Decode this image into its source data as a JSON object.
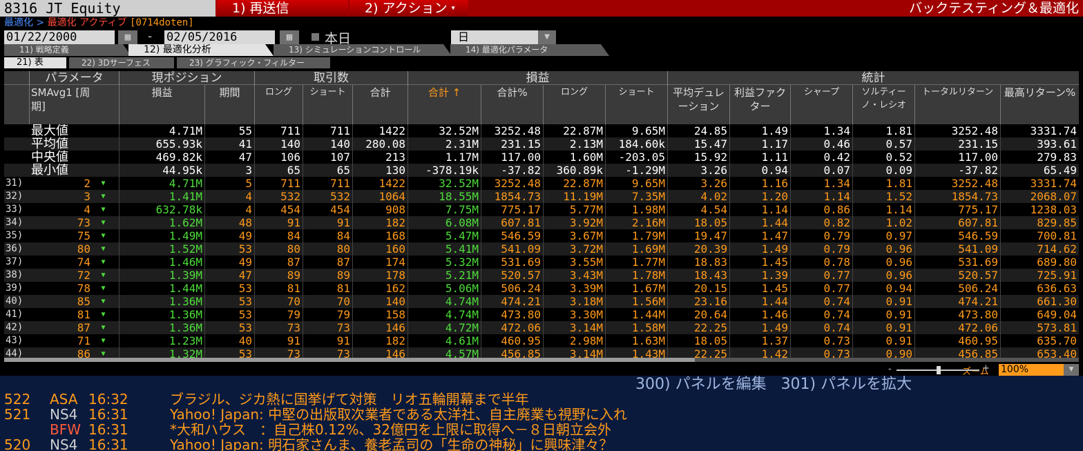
{
  "header": {
    "ticker": "8316 JT Equity",
    "btn_resend": "1) 再送信",
    "btn_action": "2) アクション",
    "title": "バックテスティング＆最適化"
  },
  "breadcrumb": {
    "level1": "最適化",
    "separator": ">",
    "level2": "最適化 アクティブ",
    "code": "[0714doten]"
  },
  "dates": {
    "start": "01/22/2000",
    "dash": "-",
    "end": "02/05/2016",
    "today_label": "本日",
    "interval": "日"
  },
  "tabs": [
    {
      "label": "11) 戦略定義"
    },
    {
      "label": "12) 最適化分析"
    },
    {
      "label": "13) シミュレーションコントロール"
    },
    {
      "label": "14) 最適化パラメータ"
    }
  ],
  "subtabs": [
    {
      "label": "21) 表"
    },
    {
      "label": "22) 3Dサーフェス"
    },
    {
      "label": "23) グラフィック・フィルター"
    }
  ],
  "group_headers": [
    "パラメータ",
    "現ポジション",
    "取引数",
    "損益",
    "統計"
  ],
  "columns": [
    "SMAvg1 [周期]",
    "損益",
    "期間",
    "ロング",
    "ショート",
    "合計",
    "合計 ↑",
    "合計%",
    "ロング",
    "ショート",
    "平均デュレーション",
    "利益ファクター",
    "シャープ",
    "ソルティーノ・レシオ",
    "トータルリターン",
    "最高リターン%"
  ],
  "summary_rows": [
    {
      "label": "最大値",
      "pnl": "4.71M",
      "period": "55",
      "long": "711",
      "short": "711",
      "total": "1422",
      "pl_total": "32.52M",
      "pl_pct": "3252.48",
      "pl_long": "22.87M",
      "pl_short": "9.65M",
      "avg_dur": "24.85",
      "pf": "1.49",
      "sharpe": "1.34",
      "sortino": "1.81",
      "tr": "3252.48",
      "max_ret": "3331.74"
    },
    {
      "label": "平均値",
      "pnl": "655.93k",
      "period": "41",
      "long": "140",
      "short": "140",
      "total": "280.08",
      "pl_total": "2.31M",
      "pl_pct": "231.15",
      "pl_long": "2.13M",
      "pl_short": "184.60k",
      "avg_dur": "15.47",
      "pf": "1.17",
      "sharpe": "0.46",
      "sortino": "0.57",
      "tr": "231.15",
      "max_ret": "393.61"
    },
    {
      "label": "中央値",
      "pnl": "469.82k",
      "period": "47",
      "long": "106",
      "short": "107",
      "total": "213",
      "pl_total": "1.17M",
      "pl_pct": "117.00",
      "pl_long": "1.60M",
      "pl_short": "-203.05",
      "avg_dur": "15.92",
      "pf": "1.11",
      "sharpe": "0.42",
      "sortino": "0.52",
      "tr": "117.00",
      "max_ret": "279.83"
    },
    {
      "label": "最小値",
      "pnl": "44.95k",
      "period": "3",
      "long": "65",
      "short": "65",
      "total": "130",
      "pl_total": "-378.19k",
      "pl_pct": "-37.82",
      "pl_long": "360.89k",
      "pl_short": "-1.29M",
      "avg_dur": "3.26",
      "pf": "0.94",
      "sharpe": "0.07",
      "sortino": "0.09",
      "tr": "-37.82",
      "max_ret": "65.49"
    }
  ],
  "data_rows": [
    {
      "idx": "31)",
      "param": "2",
      "pnl": "4.71M",
      "period": "5",
      "long": "711",
      "short": "711",
      "total": "1422",
      "pl_total": "32.52M",
      "pl_pct": "3252.48",
      "pl_long": "22.87M",
      "pl_short": "9.65M",
      "avg_dur": "3.26",
      "pf": "1.16",
      "sharpe": "1.34",
      "sortino": "1.81",
      "tr": "3252.48",
      "max_ret": "3331.74"
    },
    {
      "idx": "32)",
      "param": "3",
      "pnl": "1.41M",
      "period": "4",
      "long": "532",
      "short": "532",
      "total": "1064",
      "pl_total": "18.55M",
      "pl_pct": "1854.73",
      "pl_long": "11.19M",
      "pl_short": "7.35M",
      "avg_dur": "4.02",
      "pf": "1.20",
      "sharpe": "1.14",
      "sortino": "1.52",
      "tr": "1854.73",
      "max_ret": "2068.07"
    },
    {
      "idx": "33)",
      "param": "4",
      "pnl": "632.78k",
      "period": "4",
      "long": "454",
      "short": "454",
      "total": "908",
      "pl_total": "7.75M",
      "pl_pct": "775.17",
      "pl_long": "5.77M",
      "pl_short": "1.98M",
      "avg_dur": "4.54",
      "pf": "1.14",
      "sharpe": "0.86",
      "sortino": "1.14",
      "tr": "775.17",
      "max_ret": "1238.03"
    },
    {
      "idx": "34)",
      "param": "73",
      "pnl": "1.62M",
      "period": "48",
      "long": "91",
      "short": "91",
      "total": "182",
      "pl_total": "6.08M",
      "pl_pct": "607.81",
      "pl_long": "3.92M",
      "pl_short": "2.16M",
      "avg_dur": "18.05",
      "pf": "1.44",
      "sharpe": "0.82",
      "sortino": "1.02",
      "tr": "607.81",
      "max_ret": "829.85"
    },
    {
      "idx": "35)",
      "param": "75",
      "pnl": "1.49M",
      "period": "49",
      "long": "84",
      "short": "84",
      "total": "168",
      "pl_total": "5.47M",
      "pl_pct": "546.59",
      "pl_long": "3.67M",
      "pl_short": "1.79M",
      "avg_dur": "19.47",
      "pf": "1.47",
      "sharpe": "0.79",
      "sortino": "0.97",
      "tr": "546.59",
      "max_ret": "700.81"
    },
    {
      "idx": "36)",
      "param": "80",
      "pnl": "1.52M",
      "period": "53",
      "long": "80",
      "short": "80",
      "total": "160",
      "pl_total": "5.41M",
      "pl_pct": "541.09",
      "pl_long": "3.72M",
      "pl_short": "1.69M",
      "avg_dur": "20.39",
      "pf": "1.49",
      "sharpe": "0.79",
      "sortino": "0.96",
      "tr": "541.09",
      "max_ret": "714.62"
    },
    {
      "idx": "37)",
      "param": "74",
      "pnl": "1.46M",
      "period": "49",
      "long": "87",
      "short": "87",
      "total": "174",
      "pl_total": "5.32M",
      "pl_pct": "531.69",
      "pl_long": "3.55M",
      "pl_short": "1.77M",
      "avg_dur": "18.83",
      "pf": "1.45",
      "sharpe": "0.78",
      "sortino": "0.96",
      "tr": "531.69",
      "max_ret": "689.80"
    },
    {
      "idx": "38)",
      "param": "72",
      "pnl": "1.39M",
      "period": "47",
      "long": "89",
      "short": "89",
      "total": "178",
      "pl_total": "5.21M",
      "pl_pct": "520.57",
      "pl_long": "3.43M",
      "pl_short": "1.78M",
      "avg_dur": "18.43",
      "pf": "1.39",
      "sharpe": "0.77",
      "sortino": "0.96",
      "tr": "520.57",
      "max_ret": "725.91"
    },
    {
      "idx": "39)",
      "param": "78",
      "pnl": "1.44M",
      "period": "53",
      "long": "81",
      "short": "81",
      "total": "162",
      "pl_total": "5.06M",
      "pl_pct": "506.24",
      "pl_long": "3.39M",
      "pl_short": "1.67M",
      "avg_dur": "20.15",
      "pf": "1.45",
      "sharpe": "0.77",
      "sortino": "0.94",
      "tr": "506.24",
      "max_ret": "636.63"
    },
    {
      "idx": "40)",
      "param": "85",
      "pnl": "1.36M",
      "period": "53",
      "long": "70",
      "short": "70",
      "total": "140",
      "pl_total": "4.74M",
      "pl_pct": "474.21",
      "pl_long": "3.18M",
      "pl_short": "1.56M",
      "avg_dur": "23.16",
      "pf": "1.44",
      "sharpe": "0.74",
      "sortino": "0.91",
      "tr": "474.21",
      "max_ret": "661.30"
    },
    {
      "idx": "41)",
      "param": "81",
      "pnl": "1.36M",
      "period": "53",
      "long": "79",
      "short": "79",
      "total": "158",
      "pl_total": "4.74M",
      "pl_pct": "473.80",
      "pl_long": "3.30M",
      "pl_short": "1.44M",
      "avg_dur": "20.64",
      "pf": "1.46",
      "sharpe": "0.74",
      "sortino": "0.91",
      "tr": "473.80",
      "max_ret": "649.04"
    },
    {
      "idx": "42)",
      "param": "87",
      "pnl": "1.36M",
      "period": "53",
      "long": "73",
      "short": "73",
      "total": "146",
      "pl_total": "4.72M",
      "pl_pct": "472.06",
      "pl_long": "3.14M",
      "pl_short": "1.58M",
      "avg_dur": "22.25",
      "pf": "1.49",
      "sharpe": "0.74",
      "sortino": "0.91",
      "tr": "472.06",
      "max_ret": "573.81"
    },
    {
      "idx": "43)",
      "param": "71",
      "pnl": "1.23M",
      "period": "40",
      "long": "91",
      "short": "91",
      "total": "182",
      "pl_total": "4.61M",
      "pl_pct": "460.95",
      "pl_long": "2.98M",
      "pl_short": "1.63M",
      "avg_dur": "18.05",
      "pf": "1.37",
      "sharpe": "0.73",
      "sortino": "0.91",
      "tr": "460.95",
      "max_ret": "635.70"
    },
    {
      "idx": "44)",
      "param": "86",
      "pnl": "1.32M",
      "period": "53",
      "long": "73",
      "short": "73",
      "total": "146",
      "pl_total": "4.57M",
      "pl_pct": "456.85",
      "pl_long": "3.14M",
      "pl_short": "1.43M",
      "avg_dur": "22.25",
      "pf": "1.42",
      "sharpe": "0.73",
      "sortino": "0.90",
      "tr": "456.85",
      "max_ret": "653.40"
    }
  ],
  "zoom": {
    "label": "ズーム",
    "minus": "-",
    "plus": "+",
    "value": "100%"
  },
  "panel_actions": {
    "edit": "300) パネルを編集",
    "expand": "301) パネルを拡大"
  },
  "news": [
    {
      "num": "522",
      "src": "ASA",
      "time": "16:32",
      "head": "ブラジル、ジカ熱に国挙げて対策　リオ五輪開幕まで半年",
      "src_color": "#ff9a1a"
    },
    {
      "num": "521",
      "src": "NS4",
      "time": "16:31",
      "head": "Yahoo! Japan: 中堅の出版取次業者である太洋社、自主廃業も視野に入れ",
      "src_color": "#cfcfcf"
    },
    {
      "num": "",
      "src": "BFW",
      "time": "16:31",
      "head": "*大和ハウス　：自己株0.12%、32億円を上限に取得へ－８日朝立会外",
      "src_color": "#ff5a3a"
    },
    {
      "num": "520",
      "src": "NS4",
      "time": "16:31",
      "head": "Yahoo! Japan: 明石家さんま、養老孟司の「生命の神秘」に興味津々？",
      "src_color": "#cfcfcf"
    }
  ]
}
